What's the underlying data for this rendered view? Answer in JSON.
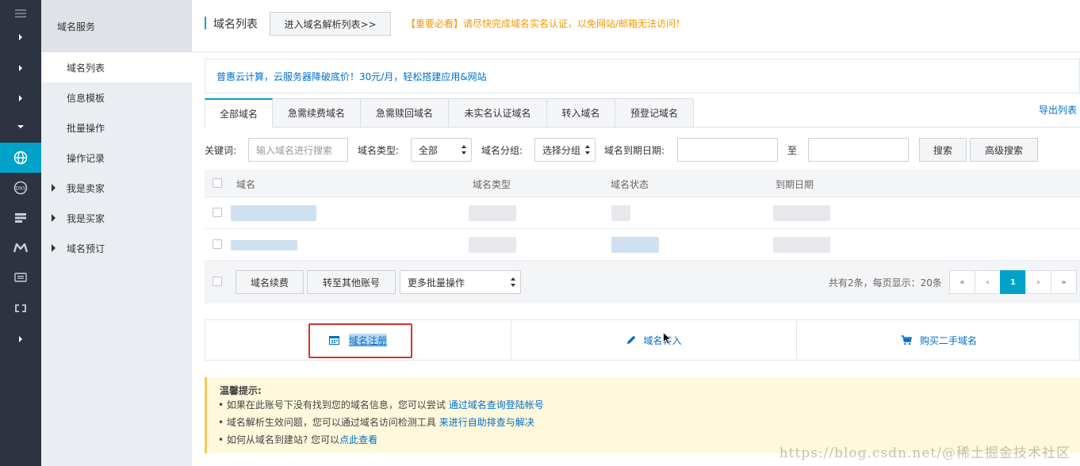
{
  "rail": {
    "icons": [
      "menu-icon",
      "chevron-right-icon",
      "chevron-right-icon",
      "chevron-right-icon",
      "chevron-down-icon",
      "globe-icon",
      "dns-icon",
      "server-icon",
      "m-logo-icon",
      "monitor-icon",
      "link-icon",
      "chevron-right-icon"
    ],
    "accent": "#00a2ca"
  },
  "nav": {
    "header": "域名服务",
    "items": [
      {
        "label": "域名列表"
      },
      {
        "label": "信息模板"
      },
      {
        "label": "批量操作"
      },
      {
        "label": "操作记录"
      },
      {
        "label": "我是卖家"
      },
      {
        "label": "我是买家"
      },
      {
        "label": "域名预订"
      }
    ]
  },
  "header": {
    "title": "域名列表",
    "dns_button": "进入域名解析列表>>",
    "notice": "【重要必看】请尽快完成域名实名认证，以免网站/邮箱无法访问！"
  },
  "promo": "普惠云计算，云服务器降破底价！30元/月，轻松搭建应用&网站",
  "tabs": [
    {
      "label": "全部域名"
    },
    {
      "label": "急需续费域名"
    },
    {
      "label": "急需赎回域名"
    },
    {
      "label": "未实名认证域名"
    },
    {
      "label": "转入域名"
    },
    {
      "label": "预登记域名"
    }
  ],
  "export_label": "导出列表",
  "filters": {
    "keyword_label": "关键词:",
    "keyword_placeholder": "输入域名进行搜索",
    "type_label": "域名类型:",
    "type_value": "全部",
    "group_label": "域名分组:",
    "group_value": "选择分组",
    "expire_label": "域名到期日期:",
    "to_label": "至",
    "search_button": "搜索",
    "advanced_button": "高级搜索"
  },
  "table": {
    "columns": [
      "域名",
      "域名类型",
      "域名状态",
      "到期日期"
    ]
  },
  "batch": {
    "renew_button": "域名续费",
    "transfer_button": "转至其他账号",
    "more_select": "更多批量操作",
    "pager_info": "共有2条，每页显示：20条",
    "pages": [
      "«",
      "‹",
      "1",
      "›",
      "»"
    ],
    "current_page": "1"
  },
  "actions": {
    "register": "域名注册",
    "transfer_in": "域名转入",
    "buy_secondhand": "购买二手域名"
  },
  "tips": {
    "title": "温馨提示:",
    "line1_text": "• 如果在此账号下没有找到您的域名信息，您可以尝试 ",
    "line1_link": "通过域名查询登陆帐号",
    "line2_text": "• 域名解析生效问题，您可以通过域名访问检测工具 ",
    "line2_link": "来进行自助排查与解决",
    "line3_text": "• 如何从域名到建站? 您可以",
    "line3_link": "点此查看"
  },
  "watermark": "https://blog.csdn.net/@稀土掘金技术社区"
}
